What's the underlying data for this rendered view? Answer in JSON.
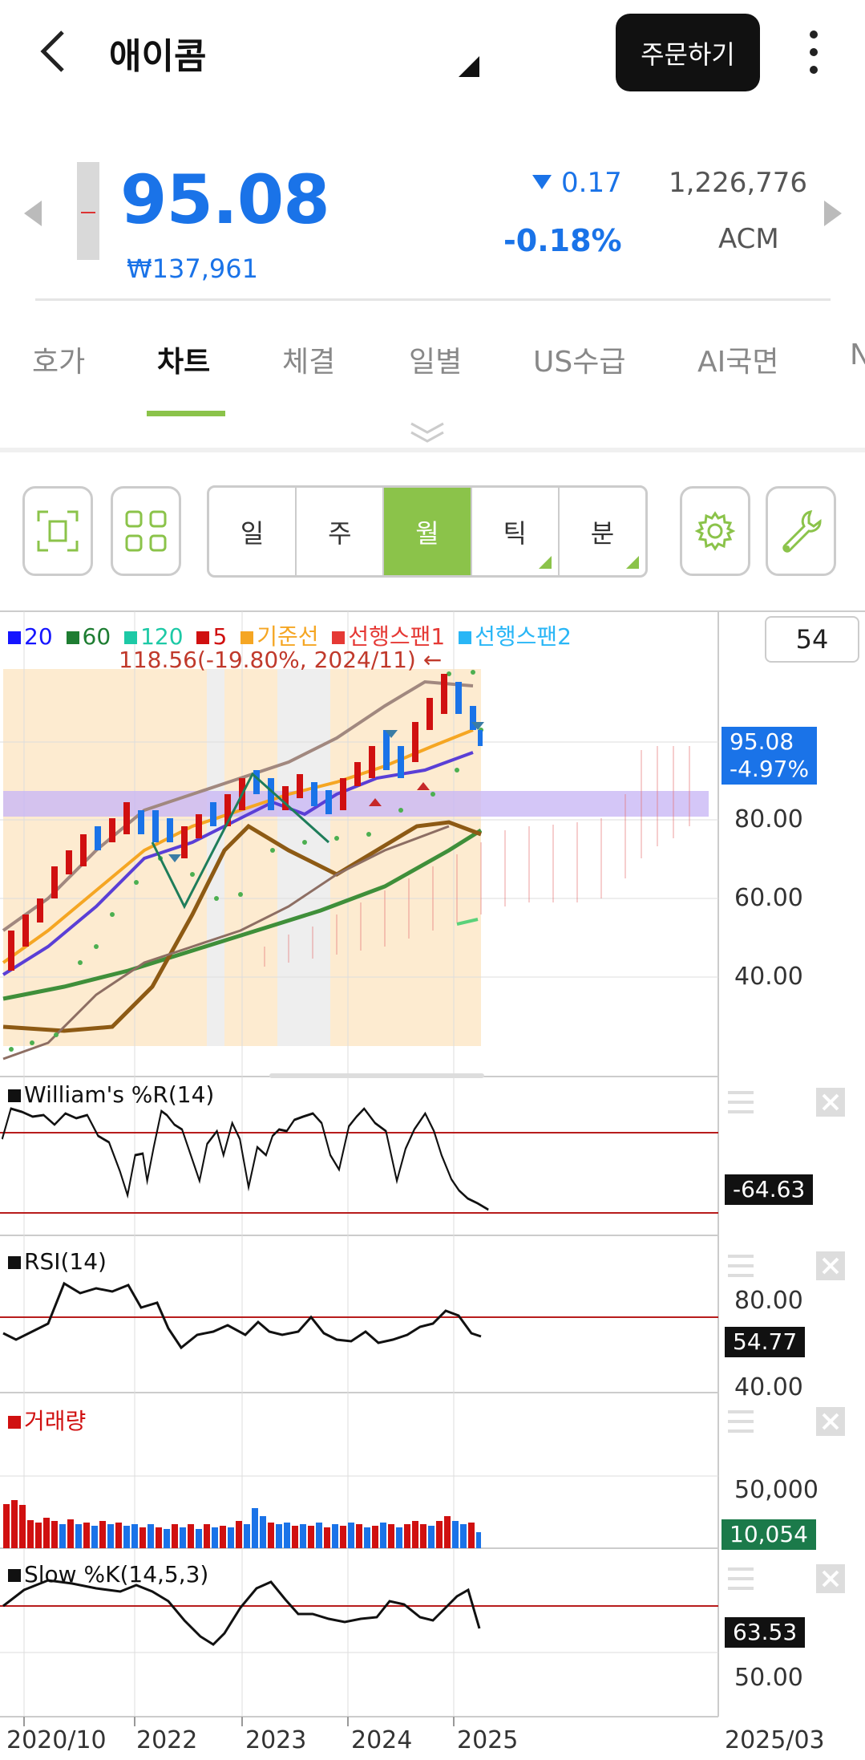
{
  "header": {
    "title": "애이콤",
    "order_button": "주문하기"
  },
  "quote": {
    "price": "95.08",
    "krw": "₩137,961",
    "change": "0.17",
    "change_pct": "-0.18%",
    "volume": "1,226,776",
    "ticker": "ACM"
  },
  "tabs": [
    {
      "label": "호가"
    },
    {
      "label": "차트"
    },
    {
      "label": "체결"
    },
    {
      "label": "일별"
    },
    {
      "label": "US수급"
    },
    {
      "label": "AI국면"
    },
    {
      "label": "N"
    }
  ],
  "periods": [
    {
      "label": "일"
    },
    {
      "label": "주"
    },
    {
      "label": "월"
    },
    {
      "label": "틱"
    },
    {
      "label": "분"
    }
  ],
  "legend": [
    {
      "label": "20",
      "color": "#1515ff"
    },
    {
      "label": "60",
      "color": "#1e7d32"
    },
    {
      "label": "120",
      "color": "#1dc9a6"
    },
    {
      "label": "5",
      "color": "#d01010"
    },
    {
      "label": "기준선",
      "color": "#f5a623"
    },
    {
      "label": "선행스팬1",
      "color": "#e53935"
    },
    {
      "label": "선행스팬2",
      "color": "#29b6f6"
    }
  ],
  "chart_count": "54",
  "annotation": "118.56(-19.80%, 2024/11) ←",
  "main_chart": {
    "price_tag": "95.08",
    "price_tag_pct": "-4.97%",
    "y_labels": [
      "80.00",
      "60.00",
      "40.00"
    ]
  },
  "panels": {
    "williams": {
      "title": "William's %R(14)",
      "value": "-64.63"
    },
    "rsi": {
      "title": "RSI(14)",
      "value": "54.77",
      "y_labels": [
        "80.00",
        "40.00"
      ]
    },
    "volume": {
      "title": "거래량",
      "value": "10,054",
      "y_label": "50,000"
    },
    "slowk": {
      "title": "Slow %K(14,5,3)",
      "value": "63.53",
      "y_label": "50.00"
    }
  },
  "x_labels": [
    "2020/10",
    "2022",
    "2023",
    "2024",
    "2025",
    "2025/03"
  ],
  "colors": {
    "accent": "#8bc34a",
    "down": "#1a73e8",
    "up": "#d01010"
  }
}
